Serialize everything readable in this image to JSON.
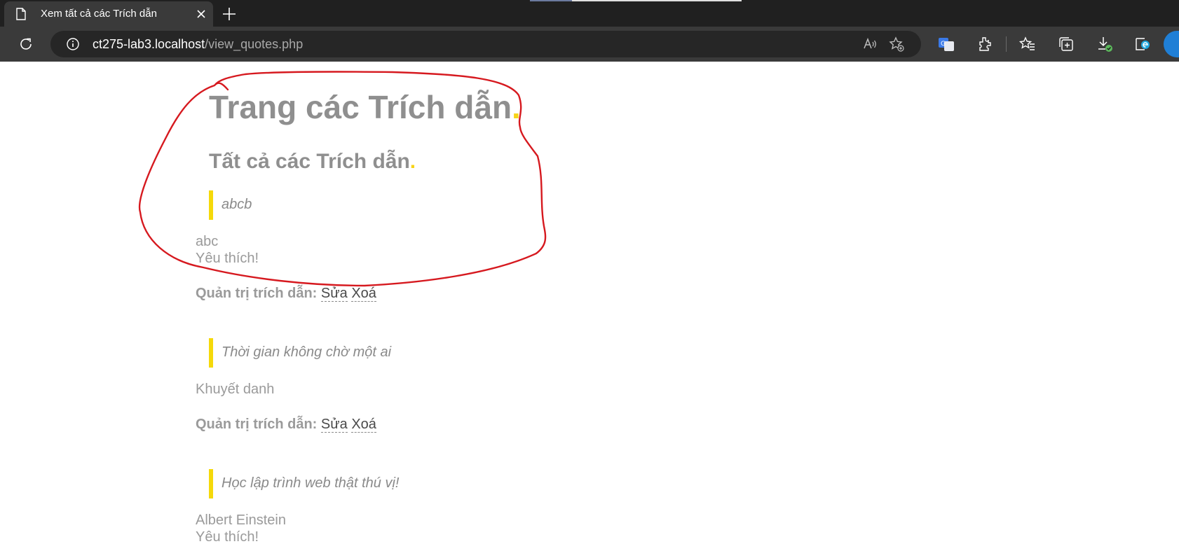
{
  "browser": {
    "tab_title": "Xem tất cả các Trích dẫn",
    "url_host": "ct275-lab3.localhost",
    "url_path": "/view_quotes.php",
    "accent": "#1f7fd6"
  },
  "page": {
    "title": "Trang các Trích dẫn",
    "title_dot": ".",
    "subtitle": "Tất cả các Trích dẫn",
    "subtitle_dot": ".",
    "quotes": [
      {
        "text": "abcb",
        "author": "abc",
        "favorite": "Yêu thích!",
        "admin_label": "Quản trị trích dẫn:",
        "edit": "Sửa",
        "delete": "Xoá"
      },
      {
        "text": "Thời gian không chờ một ai",
        "author": "Khuyết danh",
        "admin_label": "Quản trị trích dẫn:",
        "edit": "Sửa",
        "delete": "Xoá"
      },
      {
        "text": "Học lập trình web thật thú vị!",
        "author": "Albert Einstein",
        "favorite": "Yêu thích!"
      }
    ],
    "colors": {
      "heading": "#8f8f8f",
      "accent_dot": "#f7d417",
      "quote_bar": "#f5d90a",
      "annotation": "#d6191f"
    }
  },
  "icons": [
    "page-icon",
    "close-icon",
    "plus-icon",
    "reload-icon",
    "info-icon",
    "read-aloud-icon",
    "favorite-add-icon",
    "translate-icon",
    "extensions-icon",
    "favorites-icon",
    "collections-icon",
    "downloads-icon",
    "edge-icon",
    "profile-icon"
  ]
}
